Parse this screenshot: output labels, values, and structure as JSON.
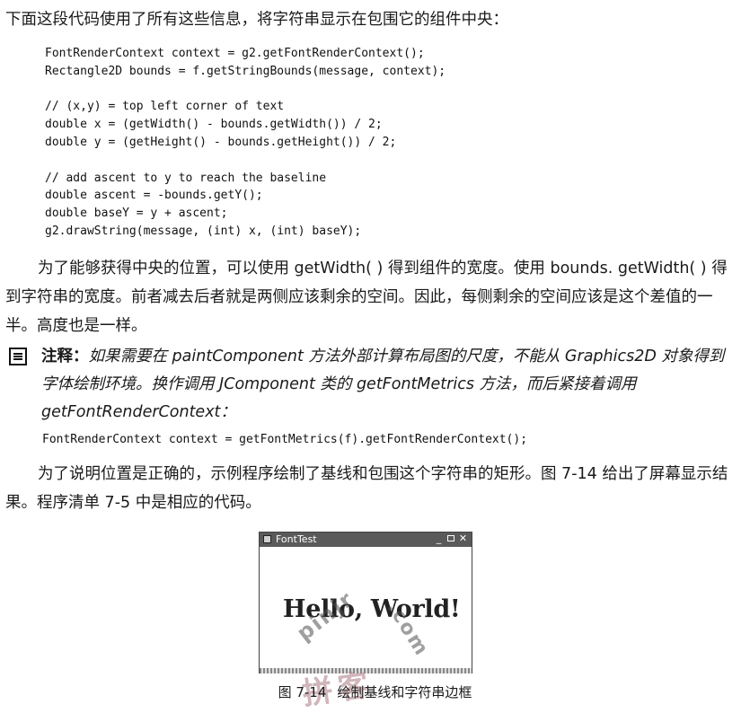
{
  "intro": "下面这段代码使用了所有这些信息，将字符串显示在包围它的组件中央：",
  "code_block_1": "FontRenderContext context = g2.getFontRenderContext();\nRectangle2D bounds = f.getStringBounds(message, context);\n\n// (x,y) = top left corner of text\ndouble x = (getWidth() - bounds.getWidth()) / 2;\ndouble y = (getHeight() - bounds.getHeight()) / 2;\n\n// add ascent to y to reach the baseline\ndouble ascent = -bounds.getY();\ndouble baseY = y + ascent;\ng2.drawString(message, (int) x, (int) baseY);",
  "paragraph_2": "为了能够获得中央的位置，可以使用 getWidth( ) 得到组件的宽度。使用 bounds. getWidth( ) 得到字符串的宽度。前者减去后者就是两侧应该剩余的空间。因此，每侧剩余的空间应该是这个差值的一半。高度也是一样。",
  "note": {
    "icon": "note-icon",
    "label": "注释：",
    "text": "如果需要在 paintComponent 方法外部计算布局图的尺度，不能从 Graphics2D 对象得到字体绘制环境。换作调用 JComponent 类的 getFontMetrics 方法，而后紧接着调用 getFontRenderContext："
  },
  "code_block_2": "FontRenderContext context = getFontMetrics(f).getFontRenderContext();",
  "paragraph_3": "为了说明位置是正确的，示例程序绘制了基线和包围这个字符串的矩形。图 7-14 给出了屏幕显示结果。程序清单 7-5 中是相应的代码。",
  "figure": {
    "window_title": "FontTest",
    "minimize_glyph": "_",
    "close_glyph": "✕",
    "message": "Hello, World!",
    "caption_number": "图 7-14",
    "caption_text": "绘制基线和字符串边框"
  },
  "watermark": {
    "arc_text": "pinjr",
    "suffix": ".com",
    "chinese": "拼客"
  }
}
